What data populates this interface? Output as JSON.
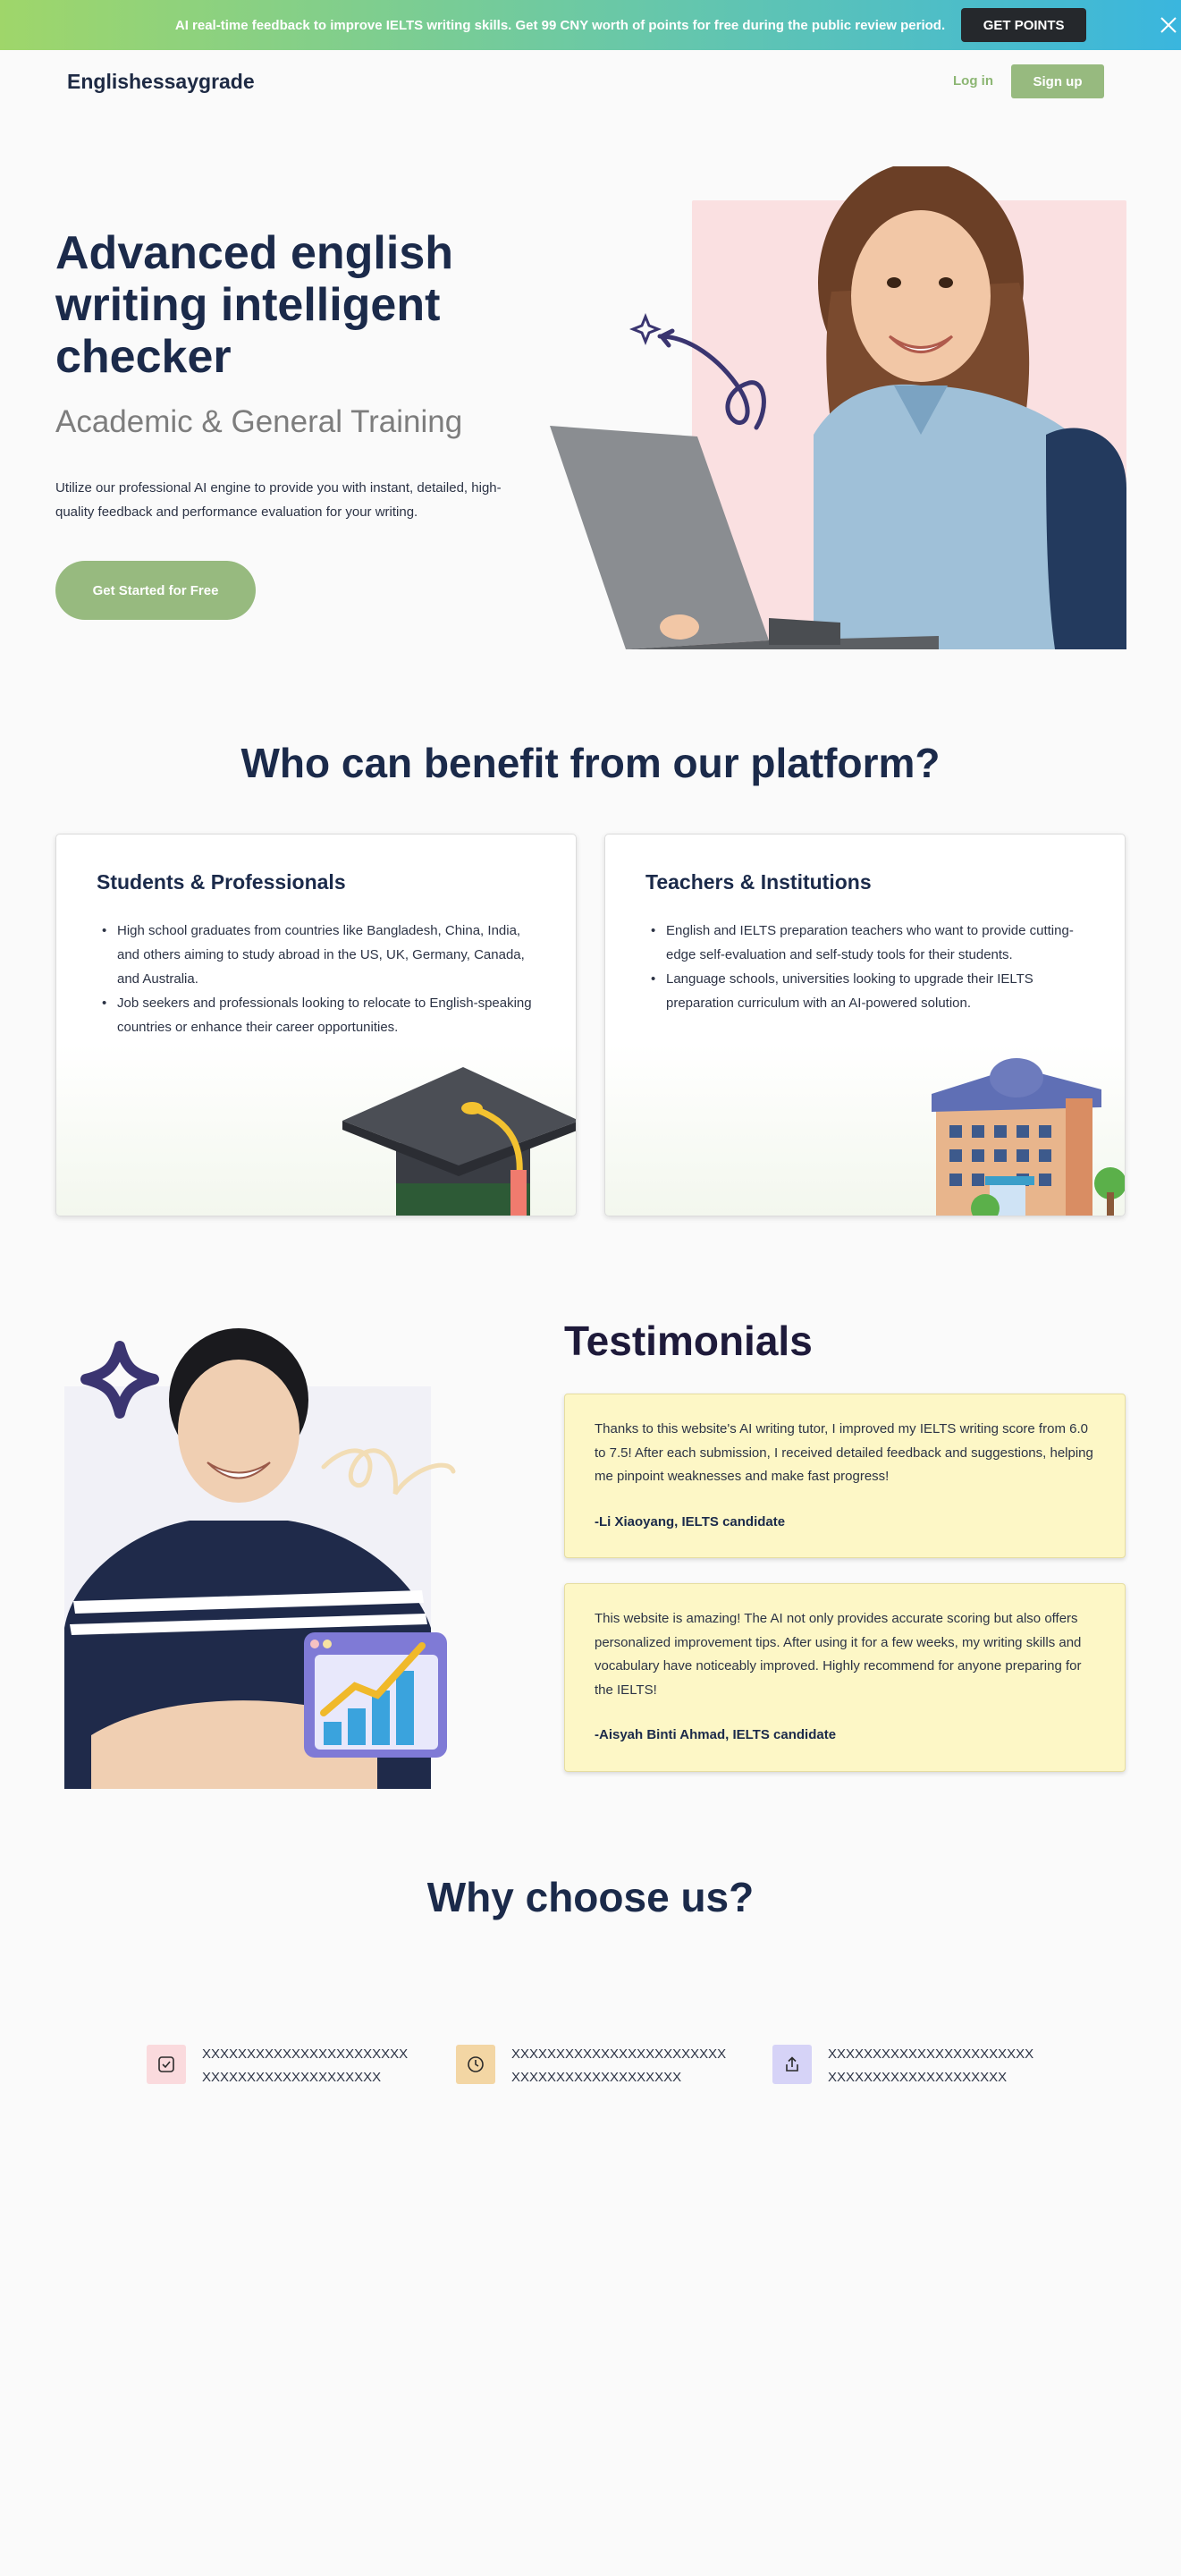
{
  "banner": {
    "text": "AI real-time feedback to improve IELTS writing skills.  Get 99 CNY worth of points for free during the public review period.",
    "button_label": "GET POINTS"
  },
  "nav": {
    "logo": "Englishessaygrade",
    "login_label": "Log in",
    "signup_label": "Sign up"
  },
  "hero": {
    "title": "Advanced english writing intelligent checker",
    "subtitle": "Academic & General Training",
    "description": "Utilize our professional AI engine to provide you with instant, detailed, high-quality feedback and performance evaluation for your writing.",
    "cta_label": "Get Started for Free"
  },
  "benefit": {
    "title": "Who can benefit from our platform?",
    "cards": [
      {
        "title": "Students & Professionals",
        "items": [
          "High school graduates from countries like Bangladesh, China, India, and others aiming to study abroad in the US, UK, Germany, Canada, and Australia.",
          "Job seekers and professionals looking to relocate to English-speaking countries or enhance their career opportunities."
        ]
      },
      {
        "title": "Teachers & Institutions",
        "items": [
          "English and IELTS preparation teachers who want to provide cutting-edge self-evaluation and self-study tools for their students.",
          "Language schools, universities looking to upgrade their IELTS preparation curriculum with an AI-powered solution."
        ]
      }
    ]
  },
  "testimonials": {
    "title": "Testimonials",
    "items": [
      {
        "quote": "Thanks to this website's AI writing tutor, I improved my IELTS writing score from 6.0 to 7.5! After each submission, I received detailed feedback and suggestions, helping me pinpoint weaknesses and make fast progress!",
        "author": "-Li Xiaoyang, IELTS candidate"
      },
      {
        "quote": "This website is amazing! The AI not only provides accurate scoring but also offers personalized improvement tips. After using it for a few weeks, my writing skills and vocabulary have noticeably improved. Highly recommend for anyone preparing for the IELTS!",
        "author": "-Aisyah Binti Ahmad, IELTS candidate"
      }
    ]
  },
  "why": {
    "title": "Why choose us?",
    "items": [
      {
        "icon": "check-square-icon",
        "color": "#fadadd",
        "text": "XXXXXXXXXXXXXXXXXXXXXXXXXXXXXXXXXXXXXXXXXXX"
      },
      {
        "icon": "clock-icon",
        "color": "#f3d6a4",
        "text": "XXXXXXXXXXXXXXXXXXXXXXXXXXXXXXXXXXXXXXXXXXX"
      },
      {
        "icon": "share-icon",
        "color": "#d6d3f7",
        "text": "XXXXXXXXXXXXXXXXXXXXXXXXXXXXXXXXXXXXXXXXXXX"
      }
    ]
  },
  "colors": {
    "accent_green": "#97ba7f",
    "heading_navy": "#1b2a4a",
    "testimonial_bg": "#fdf7c6"
  }
}
